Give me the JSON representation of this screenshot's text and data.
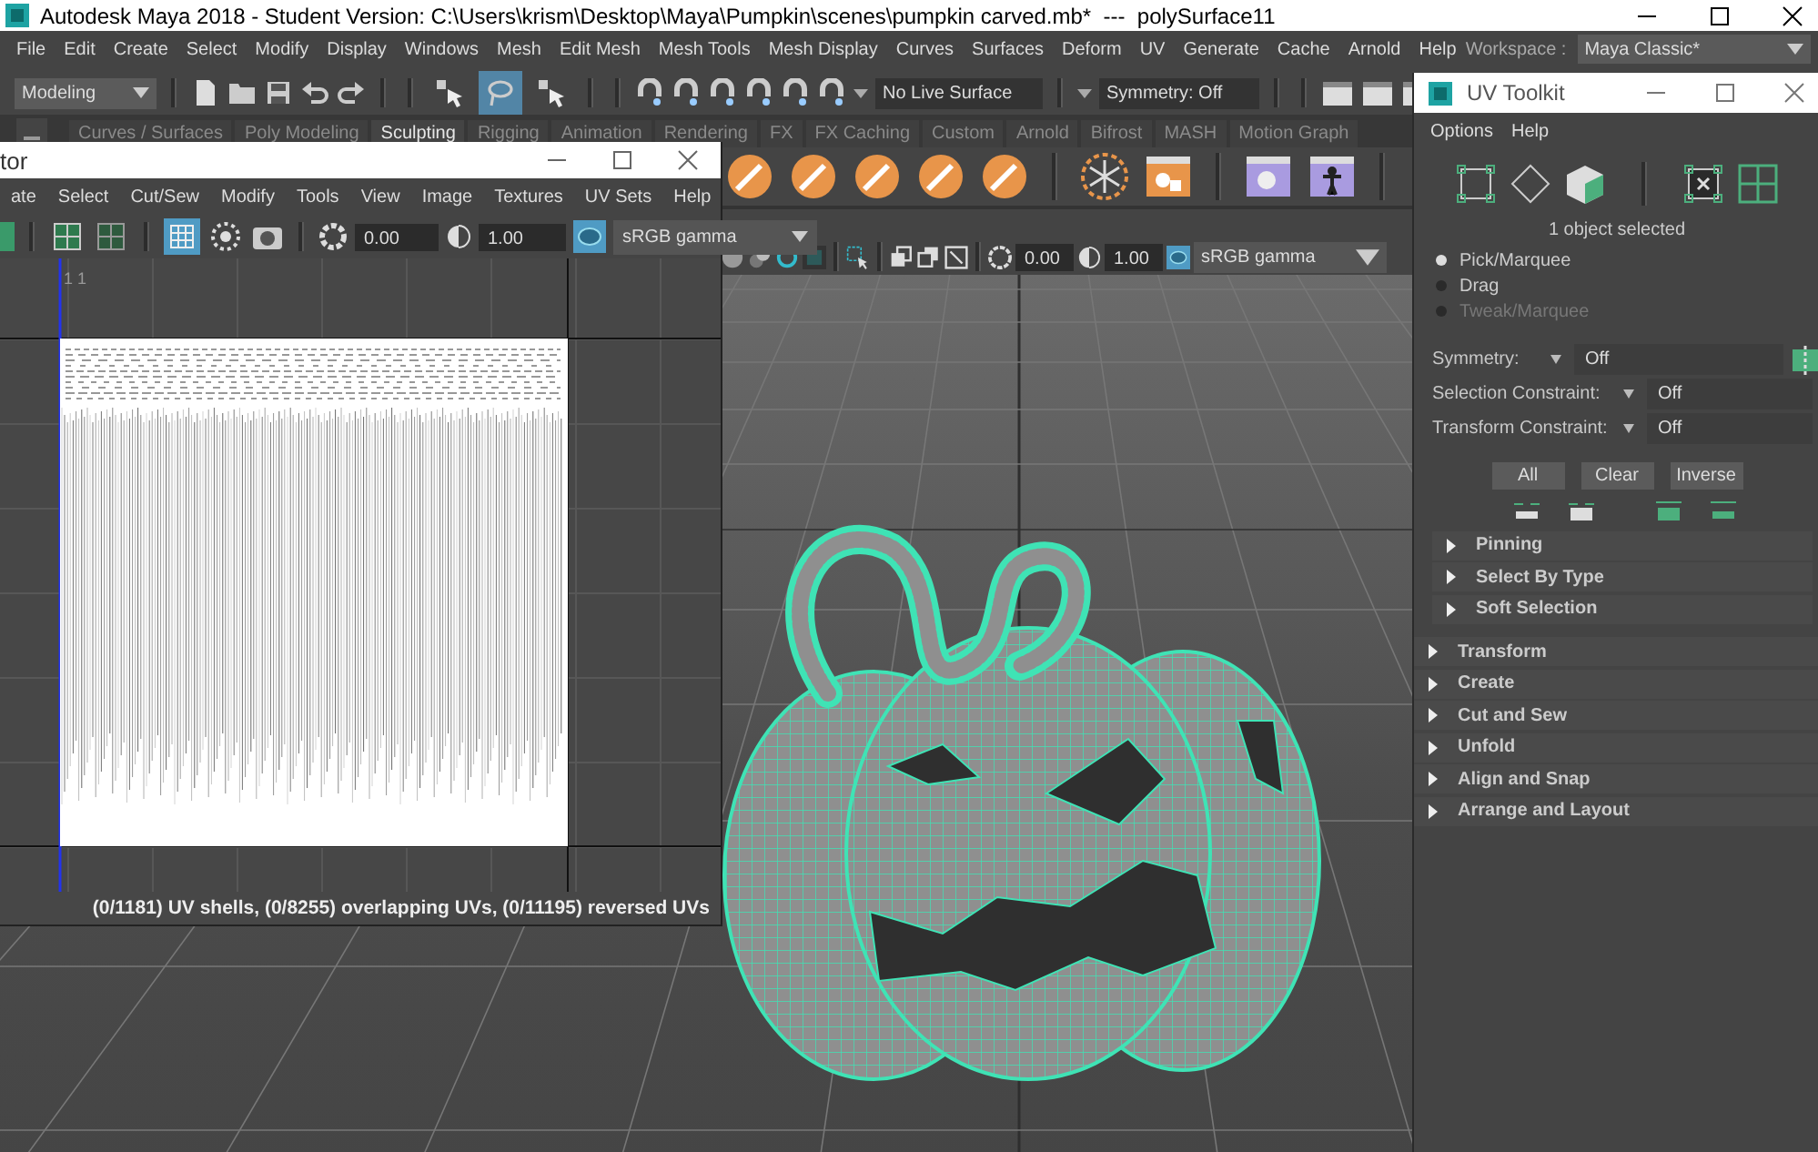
{
  "window": {
    "title": "Autodesk Maya 2018 - Student Version: C:\\Users\\krism\\Desktop\\Maya\\Pumpkin\\scenes\\pumpkin carved.mb*  ---  polySurface11"
  },
  "menu_bar": {
    "items": [
      "File",
      "Edit",
      "Create",
      "Select",
      "Modify",
      "Display",
      "Windows",
      "Mesh",
      "Edit Mesh",
      "Mesh Tools",
      "Mesh Display",
      "Curves",
      "Surfaces",
      "Deform",
      "UV",
      "Generate",
      "Cache",
      "Arnold",
      "Help"
    ],
    "workspace_label": "Workspace :",
    "workspace_value": "Maya Classic*"
  },
  "status_line": {
    "menu_set": "Modeling",
    "select_modes": [
      {
        "selected": false
      },
      {
        "selected": true
      },
      {
        "selected": false
      }
    ],
    "live_surface": "No Live Surface",
    "symmetry": "Symmetry: Off"
  },
  "shelf_tabs": [
    {
      "label": "Curves / Surfaces",
      "selected": false
    },
    {
      "label": "Poly Modeling",
      "selected": false
    },
    {
      "label": "Sculpting",
      "selected": true
    },
    {
      "label": "Rigging",
      "selected": false
    },
    {
      "label": "Animation",
      "selected": false
    },
    {
      "label": "Rendering",
      "selected": false
    },
    {
      "label": "FX",
      "selected": false
    },
    {
      "label": "FX Caching",
      "selected": false
    },
    {
      "label": "Custom",
      "selected": false
    },
    {
      "label": "Arnold",
      "selected": false
    },
    {
      "label": "Bifrost",
      "selected": false
    },
    {
      "label": "MASH",
      "selected": false
    },
    {
      "label": "Motion Graph",
      "selected": false
    }
  ],
  "viewport": {
    "exposure": "0.00",
    "gamma": "1.00",
    "color_space": "sRGB gamma"
  },
  "uv_editor": {
    "title": "tor",
    "menu": [
      "ate",
      "Select",
      "Cut/Sew",
      "Modify",
      "Tools",
      "View",
      "Image",
      "Textures",
      "UV Sets",
      "Help"
    ],
    "toggles": [
      {
        "selected": false
      },
      {
        "selected": false
      },
      {
        "selected": true
      },
      {
        "selected": false
      }
    ],
    "exposure": "0.00",
    "gamma": "1.00",
    "color_space": "sRGB gamma",
    "axis_label": "1 1",
    "status": "(0/1181) UV shells, (0/8255) overlapping UVs, (0/11195) reversed UVs"
  },
  "uv_toolkit": {
    "title": "UV Toolkit",
    "menu": [
      "Options",
      "Help"
    ],
    "selection_info": "1 object selected",
    "modes": [
      {
        "label": "Pick/Marquee",
        "selected": true,
        "disabled": false
      },
      {
        "label": "Drag",
        "selected": false,
        "disabled": false
      },
      {
        "label": "Tweak/Marquee",
        "selected": false,
        "disabled": true
      }
    ],
    "options": [
      {
        "label": "Symmetry:",
        "value": "Off"
      },
      {
        "label": "Selection Constraint:",
        "value": "Off"
      },
      {
        "label": "Transform Constraint:",
        "value": "Off"
      }
    ],
    "buttons": [
      "All",
      "Clear",
      "Inverse"
    ],
    "selection_sections": [
      {
        "label": "Pinning",
        "expanded": false
      },
      {
        "label": "Select By Type",
        "expanded": false
      },
      {
        "label": "Soft Selection",
        "expanded": false
      }
    ],
    "sections": [
      {
        "label": "Transform",
        "expanded": false
      },
      {
        "label": "Create",
        "expanded": false
      },
      {
        "label": "Cut and Sew",
        "expanded": false
      },
      {
        "label": "Unfold",
        "expanded": false
      },
      {
        "label": "Align and Snap",
        "expanded": false
      },
      {
        "label": "Arrange and Layout",
        "expanded": false
      }
    ]
  }
}
